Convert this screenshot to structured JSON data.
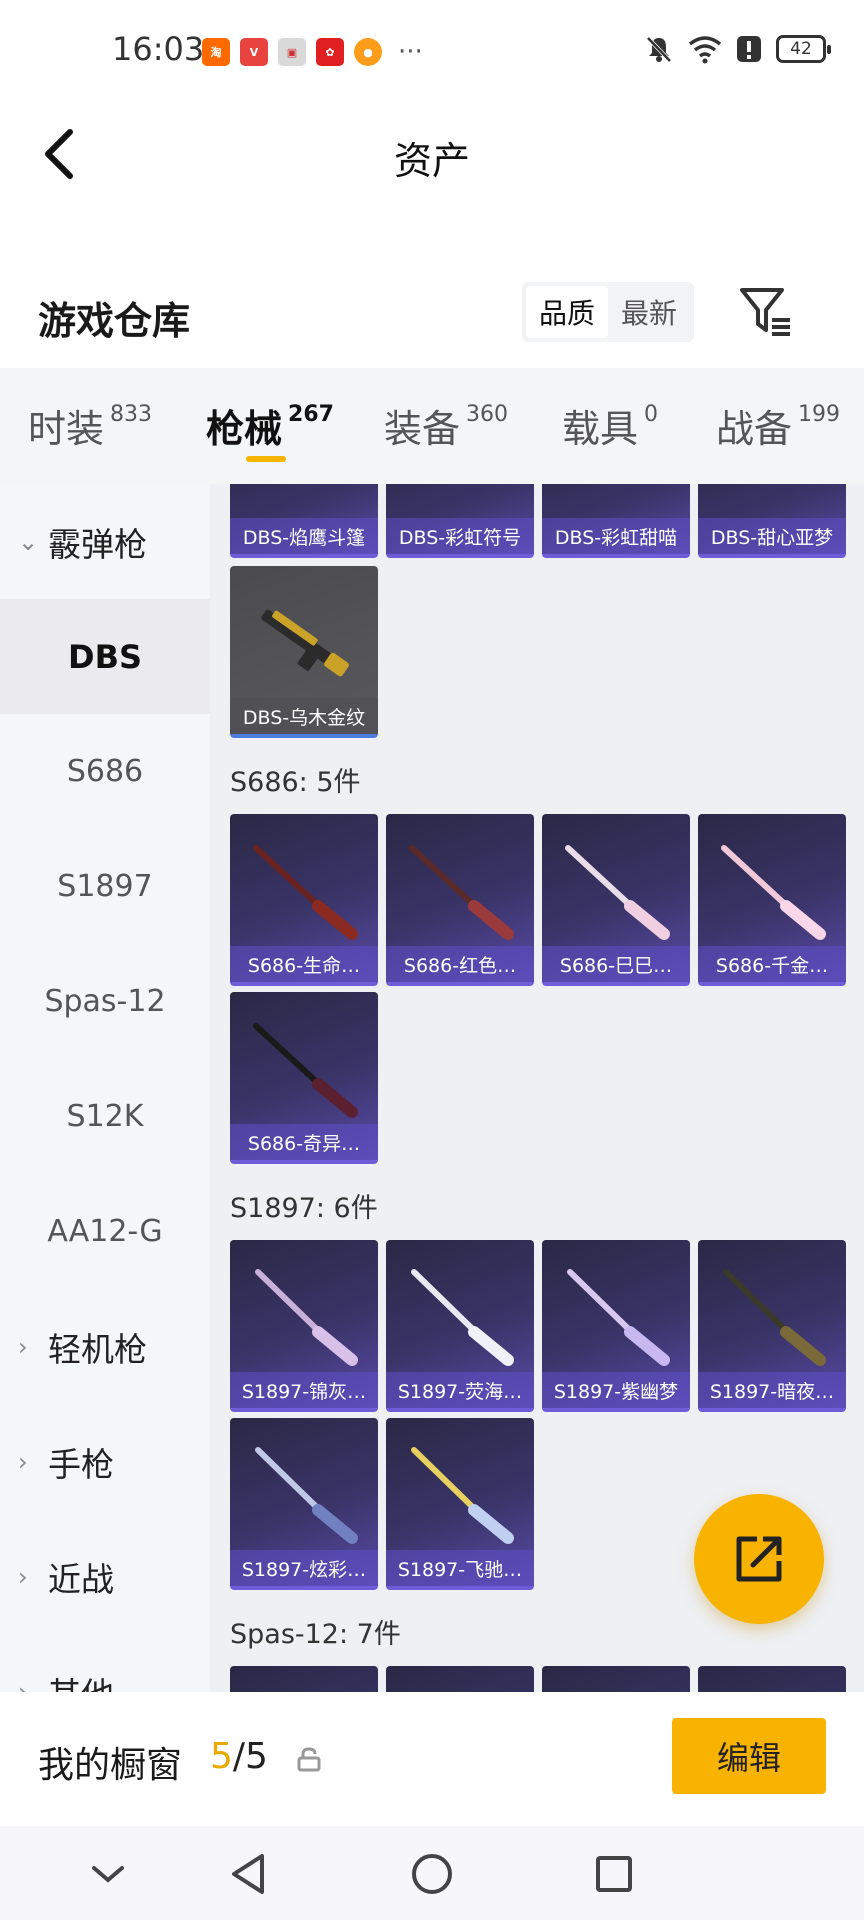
{
  "status_bar": {
    "time": "16:03",
    "apps": [
      {
        "name": "taobao-icon",
        "color": "#ff6a00",
        "glyph": "淘"
      },
      {
        "name": "vmall-icon",
        "color": "#e8433e",
        "glyph": "V"
      },
      {
        "name": "box-icon",
        "color": "#d9d9d9",
        "glyph": "▣"
      },
      {
        "name": "qr-icon",
        "color": "#e02020",
        "glyph": "✿"
      },
      {
        "name": "cat-icon",
        "color": "#ff9d1a",
        "glyph": "●"
      }
    ],
    "more": "···",
    "battery": "42"
  },
  "header": {
    "title": "资产"
  },
  "warehouse": {
    "title": "游戏仓库",
    "sort_options": [
      "品质",
      "最新"
    ],
    "active_sort": "品质"
  },
  "tabs": [
    {
      "label": "时装",
      "count": "833"
    },
    {
      "label": "枪械",
      "count": "267",
      "active": true
    },
    {
      "label": "装备",
      "count": "360"
    },
    {
      "label": "载具",
      "count": "0"
    },
    {
      "label": "战备",
      "count": "199"
    }
  ],
  "sidebar": {
    "items": [
      {
        "label": "霰弹枪",
        "type": "category",
        "expanded": true
      },
      {
        "label": "DBS",
        "type": "sub",
        "active": true
      },
      {
        "label": "S686",
        "type": "sub"
      },
      {
        "label": "S1897",
        "type": "sub"
      },
      {
        "label": "Spas-12",
        "type": "sub"
      },
      {
        "label": "S12K",
        "type": "sub"
      },
      {
        "label": "AA12-G",
        "type": "sub"
      },
      {
        "label": "轻机枪",
        "type": "category"
      },
      {
        "label": "手枪",
        "type": "category"
      },
      {
        "label": "近战",
        "type": "category"
      },
      {
        "label": "其他",
        "type": "category"
      }
    ]
  },
  "content": {
    "dbs_top_row": [
      "DBS-焰鹰斗篷",
      "DBS-彩虹符号",
      "DBS-彩虹甜喵",
      "DBS-甜心亚梦"
    ],
    "dbs_extra": [
      "DBS-乌木金纹"
    ],
    "sections": [
      {
        "title": "S686: 5件",
        "items": [
          "S686-生命…",
          "S686-红色…",
          "S686-巳巳…",
          "S686-千金…",
          "S686-奇异…"
        ]
      },
      {
        "title": "S1897: 6件",
        "items": [
          "S1897-锦灰…",
          "S1897-荧海…",
          "S1897-紫幽梦",
          "S1897-暗夜…",
          "S1897-炫彩…",
          "S1897-飞驰…"
        ]
      },
      {
        "title": "Spas-12: 7件",
        "items": []
      }
    ]
  },
  "bottom_bar": {
    "label": "我的橱窗",
    "count_current": "5",
    "count_sep": "/",
    "count_total": "5",
    "edit_label": "编辑"
  },
  "colors": {
    "accent": "#f7b300",
    "card_purple": "#3a3468",
    "card_caption": "#5e4ec8"
  }
}
